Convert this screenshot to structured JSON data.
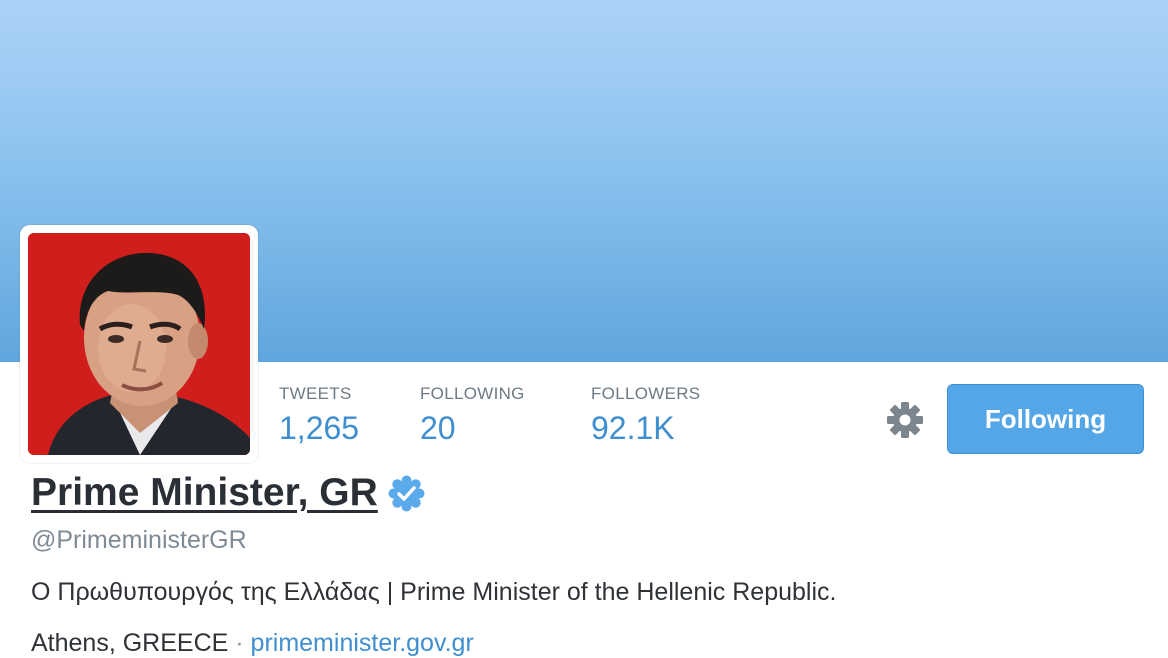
{
  "profile": {
    "name": "Prime Minister, GR",
    "handle": "@PrimeministerGR",
    "bio": "Ο Πρωθυπουργός της Ελλάδας | Prime Minister of the Hellenic Republic.",
    "location": "Athens, GREECE",
    "separator": "·",
    "website": "primeminister.gov.gr",
    "verified_icon": "verified-badge-icon"
  },
  "stats": [
    {
      "label": "TWEETS",
      "value": "1,265"
    },
    {
      "label": "FOLLOWING",
      "value": "20"
    },
    {
      "label": "FOLLOWERS",
      "value": "92.1K"
    }
  ],
  "actions": {
    "follow_label": "Following",
    "settings_icon": "gear-icon"
  },
  "colors": {
    "accent": "#55a6e6",
    "link": "#3f8ed0",
    "banner": "#8cc2ee",
    "avatar_bg": "#d8221e"
  }
}
